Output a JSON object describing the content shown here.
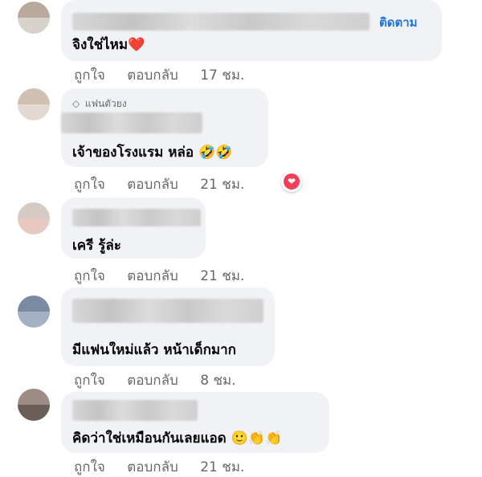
{
  "colors": {
    "bubble": "#f0f2f5",
    "meta": "#65676b",
    "link": "#1b74e4",
    "love": "#f33e58"
  },
  "comments": [
    {
      "text": "จิงใช่ไหม",
      "emoji": "❤️",
      "follow": "ติดตาม",
      "like": "ถูกใจ",
      "reply": "ตอบกลับ",
      "time": "17 ชม."
    },
    {
      "badge": "แฟนตัวยง",
      "badge_icon": "diamond-icon",
      "text": "เจ้าของโรงแรม หล่อ",
      "emoji": "🤣🤣",
      "like": "ถูกใจ",
      "reply": "ตอบกลับ",
      "time": "21 ชม.",
      "reaction": "❤"
    },
    {
      "text": "เครี รู้ล่ะ",
      "like": "ถูกใจ",
      "reply": "ตอบกลับ",
      "time": "21 ชม."
    },
    {
      "text": "มีแฟนใหม่แล้ว หน้าเด็กมาก",
      "like": "ถูกใจ",
      "reply": "ตอบกลับ",
      "time": "8 ชม."
    },
    {
      "text": "คิดว่าใช่เหมือนกันเลยแอด",
      "emoji": "🙂👏👏",
      "like": "ถูกใจ",
      "reply": "ตอบกลับ",
      "time": "21 ชม."
    }
  ]
}
